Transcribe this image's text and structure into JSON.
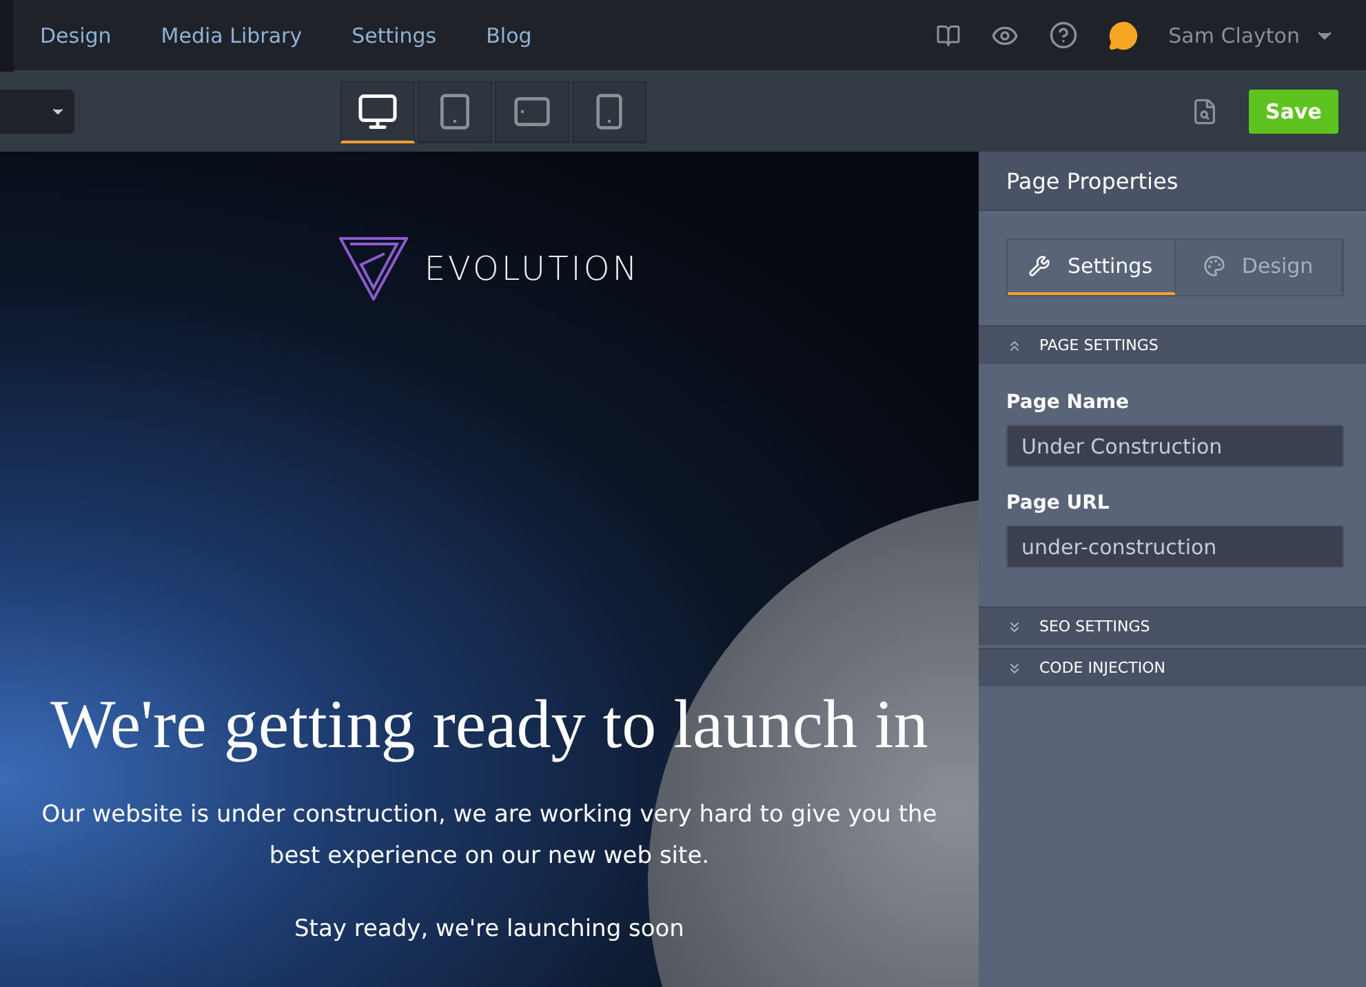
{
  "nav": {
    "items": [
      "Design",
      "Media Library",
      "Settings",
      "Blog"
    ],
    "user": "Sam Clayton"
  },
  "toolbar": {
    "devices": [
      {
        "kind": "desktop",
        "selected": true
      },
      {
        "kind": "tablet",
        "selected": false
      },
      {
        "kind": "tablet-landscape",
        "selected": false
      },
      {
        "kind": "phone",
        "selected": false
      }
    ],
    "save": "Save"
  },
  "preview": {
    "logo": "EVOLUTION",
    "heading": "We're getting ready to launch in",
    "text": "Our website is under construction, we are working very hard to give you the best experience on our new web site.",
    "tagline": "Stay ready, we're launching soon"
  },
  "panel": {
    "title": "Page Properties",
    "tabs": [
      {
        "label": "Settings",
        "kind": "settings",
        "selected": true
      },
      {
        "label": "Design",
        "kind": "design",
        "selected": false
      }
    ],
    "sections": [
      {
        "title": "PAGE SETTINGS",
        "expanded": true,
        "fields": [
          {
            "label": "Page Name",
            "value": "Under Construction"
          },
          {
            "label": "Page URL",
            "value": "under-construction"
          }
        ]
      },
      {
        "title": "SEO SETTINGS",
        "expanded": false
      },
      {
        "title": "CODE INJECTION",
        "expanded": false
      }
    ]
  }
}
